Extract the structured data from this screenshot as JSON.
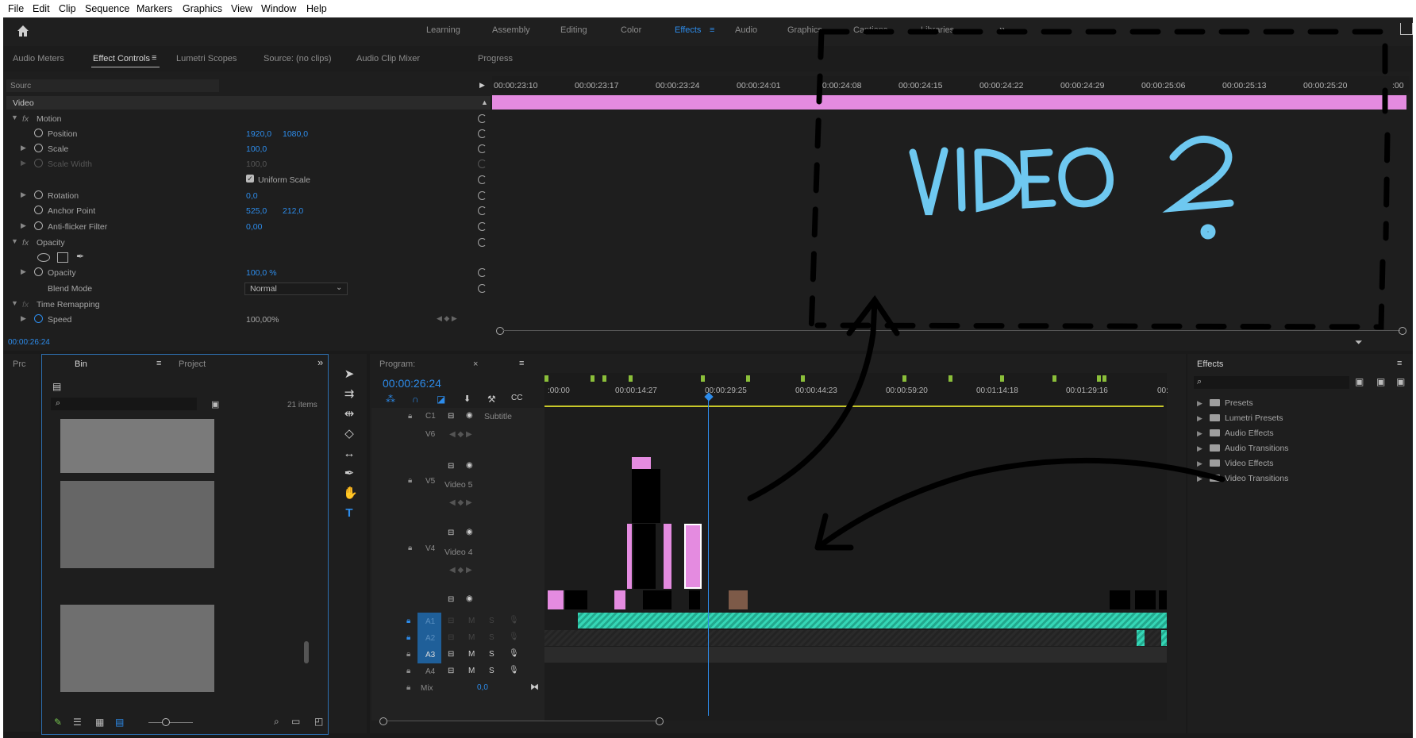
{
  "menu": [
    "File",
    "Edit",
    "Clip",
    "Sequence",
    "Markers",
    "Graphics",
    "View",
    "Window",
    "Help"
  ],
  "workspaces": [
    "Learning",
    "Assembly",
    "Editing",
    "Color",
    "Effects",
    "Audio",
    "Graphics",
    "Captions",
    "Libraries"
  ],
  "workspace_more": "»",
  "top_panel_tabs": {
    "audio_meters": "Audio Meters",
    "effect_controls": "Effect Controls",
    "lumetri_scopes": "Lumetri Scopes",
    "source": "Source: (no clips)",
    "audio_clip_mixer": "Audio Clip Mixer",
    "progress": "Progress"
  },
  "effect_controls": {
    "source_label": "Sourc",
    "section_video": "Video",
    "motion": "Motion",
    "position": {
      "label": "Position",
      "x": "1920,0",
      "y": "1080,0"
    },
    "scale": {
      "label": "Scale",
      "value": "100,0"
    },
    "scale_width": {
      "label": "Scale Width",
      "value": "100,0"
    },
    "uniform_scale": "Uniform Scale",
    "rotation": {
      "label": "Rotation",
      "value": "0,0"
    },
    "anchor_point": {
      "label": "Anchor Point",
      "x": "525,0",
      "y": "212,0"
    },
    "anti_flicker": {
      "label": "Anti-flicker Filter",
      "value": "0,00"
    },
    "opacity_section": "Opacity",
    "opacity": {
      "label": "Opacity",
      "value": "100,0 %"
    },
    "blend_mode": {
      "label": "Blend Mode",
      "value": "Normal"
    },
    "time_remapping": "Time Remapping",
    "speed": {
      "label": "Speed",
      "value": "100,00%"
    },
    "timecode": "00:00:26:24"
  },
  "ec_ruler": [
    "00:00:23:10",
    "00:00:23:17",
    "00:00:23:24",
    "00:00:24:01",
    "00:00:24:08",
    "00:00:24:15",
    "00:00:24:22",
    "00:00:24:29",
    "00:00:25:06",
    "00:00:25:13",
    "00:00:25:20",
    ":00"
  ],
  "annotation": {
    "handwritten": "VIDEO 2"
  },
  "project_panel": {
    "tab_prc": "Prc",
    "tab_bin": "Bin",
    "tab_project": "Project",
    "items_count": "21 items"
  },
  "timeline": {
    "program_tab": "Program:",
    "timecode": "00:00:26:24",
    "ruler": [
      ":00:00",
      "00:00:14:27",
      "00:00:29:25",
      "00:00:44:23",
      "00:00:59:20",
      "00:01:14:18",
      "00:01:29:16",
      "00:"
    ],
    "tracks": {
      "c1": {
        "id": "C1",
        "name": "Subtitle"
      },
      "v6": {
        "id": "V6"
      },
      "v5": {
        "id": "V5",
        "name": "Video 5"
      },
      "v4": {
        "id": "V4",
        "name": "Video 4"
      },
      "a1": {
        "id": "A1"
      },
      "a2": {
        "id": "A2"
      },
      "a3": {
        "id": "A3"
      },
      "a4": {
        "id": "A4"
      },
      "mix": {
        "name": "Mix",
        "value": "0,0"
      }
    },
    "m_label": "M",
    "s_label": "S"
  },
  "effects_panel": {
    "title": "Effects",
    "items": [
      "Presets",
      "Lumetri Presets",
      "Audio Effects",
      "Audio Transitions",
      "Video Effects",
      "Video Transitions"
    ]
  },
  "colors": {
    "accent": "#2d8ceb",
    "clip_pink": "#e48be0",
    "audio_teal": "#35d6b6",
    "annotation_blue": "#6ec8f0"
  }
}
